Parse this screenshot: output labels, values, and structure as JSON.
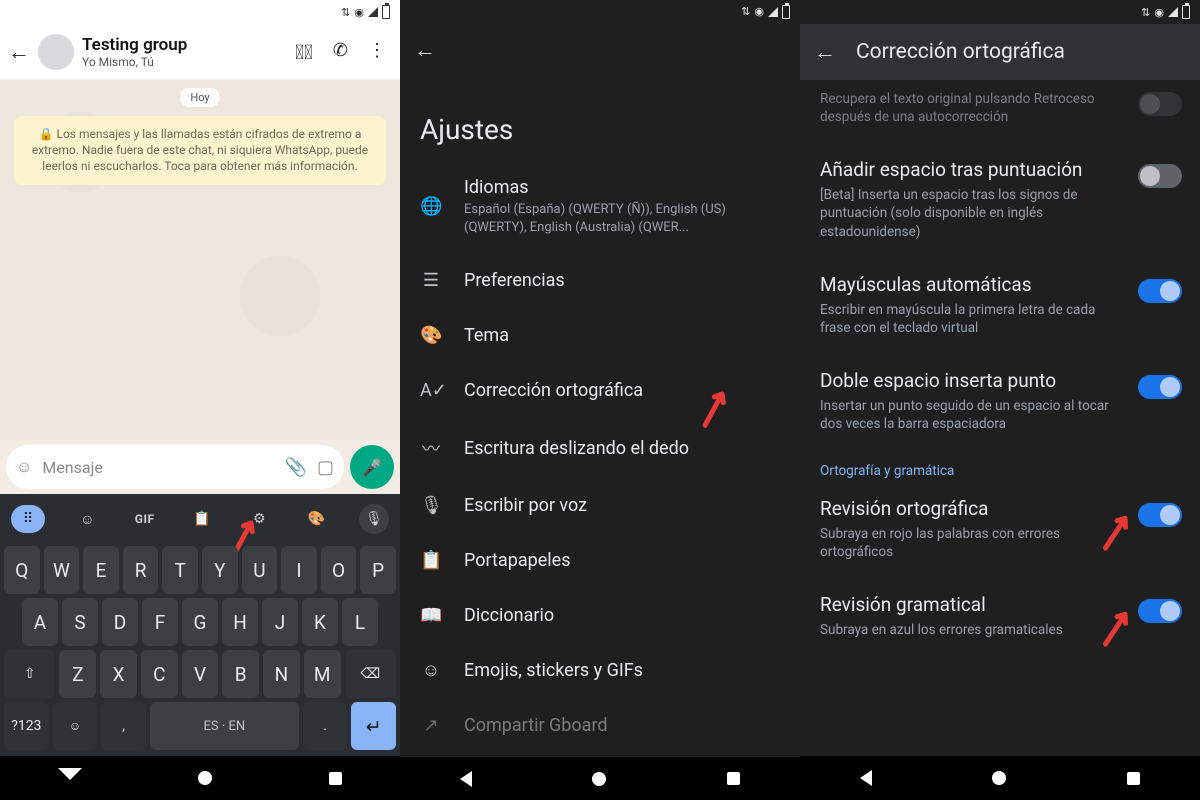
{
  "screen1": {
    "chat_title": "Testing group",
    "chat_subtitle": "Yo Mismo, Tú",
    "date_chip": "Hoy",
    "encryption_notice": "🔒 Los mensajes y las llamadas están cifrados de extremo a extremo. Nadie fuera de este chat, ni siquiera WhatsApp, puede leerlos ni escucharlos. Toca para obtener más información.",
    "input_placeholder": "Mensaje",
    "keyboard": {
      "gif_label": "GIF",
      "rows": {
        "r1": [
          "Q",
          "W",
          "E",
          "R",
          "T",
          "Y",
          "U",
          "I",
          "O",
          "P"
        ],
        "r2": [
          "A",
          "S",
          "D",
          "F",
          "G",
          "H",
          "J",
          "K",
          "L"
        ],
        "r3": [
          "Z",
          "X",
          "C",
          "V",
          "B",
          "N",
          "M"
        ]
      },
      "num_key": "?123",
      "space_label": "ES · EN",
      "period": ".",
      "comma": ","
    }
  },
  "screen2": {
    "heading": "Ajustes",
    "items": [
      {
        "label": "Idiomas",
        "sub": "Español (España) (QWERTY (Ñ)), English (US) (QWERTY), English (Australia) (QWER..."
      },
      {
        "label": "Preferencias"
      },
      {
        "label": "Tema"
      },
      {
        "label": "Corrección ortográfica"
      },
      {
        "label": "Escritura deslizando el dedo"
      },
      {
        "label": "Escribir por voz"
      },
      {
        "label": "Portapapeles"
      },
      {
        "label": "Diccionario"
      },
      {
        "label": "Emojis, stickers y GIFs"
      }
    ],
    "peek_label": "Compartir Gboard"
  },
  "screen3": {
    "title": "Corrección ortográfica",
    "items": [
      {
        "title": "",
        "sub": "Recupera el texto original pulsando Retroceso después de una autocorrección",
        "on": false,
        "faded": true
      },
      {
        "title": "Añadir espacio tras puntuación",
        "sub": "[Beta] Inserta un espacio tras los signos de puntuación (solo disponible en inglés estadounidense)",
        "on": false
      },
      {
        "title": "Mayúsculas automáticas",
        "sub": "Escribir en mayúscula la primera letra de cada frase con el teclado virtual",
        "on": true
      },
      {
        "title": "Doble espacio inserta punto",
        "sub": "Insertar un punto seguido de un espacio al tocar dos veces la barra espaciadora",
        "on": true
      }
    ],
    "section_header": "Ortografía y gramática",
    "items2": [
      {
        "title": "Revisión ortográfica",
        "sub": "Subraya en rojo las palabras con errores ortográficos",
        "on": true
      },
      {
        "title": "Revisión gramatical",
        "sub": "Subraya en azul los errores gramaticales",
        "on": true
      }
    ]
  }
}
